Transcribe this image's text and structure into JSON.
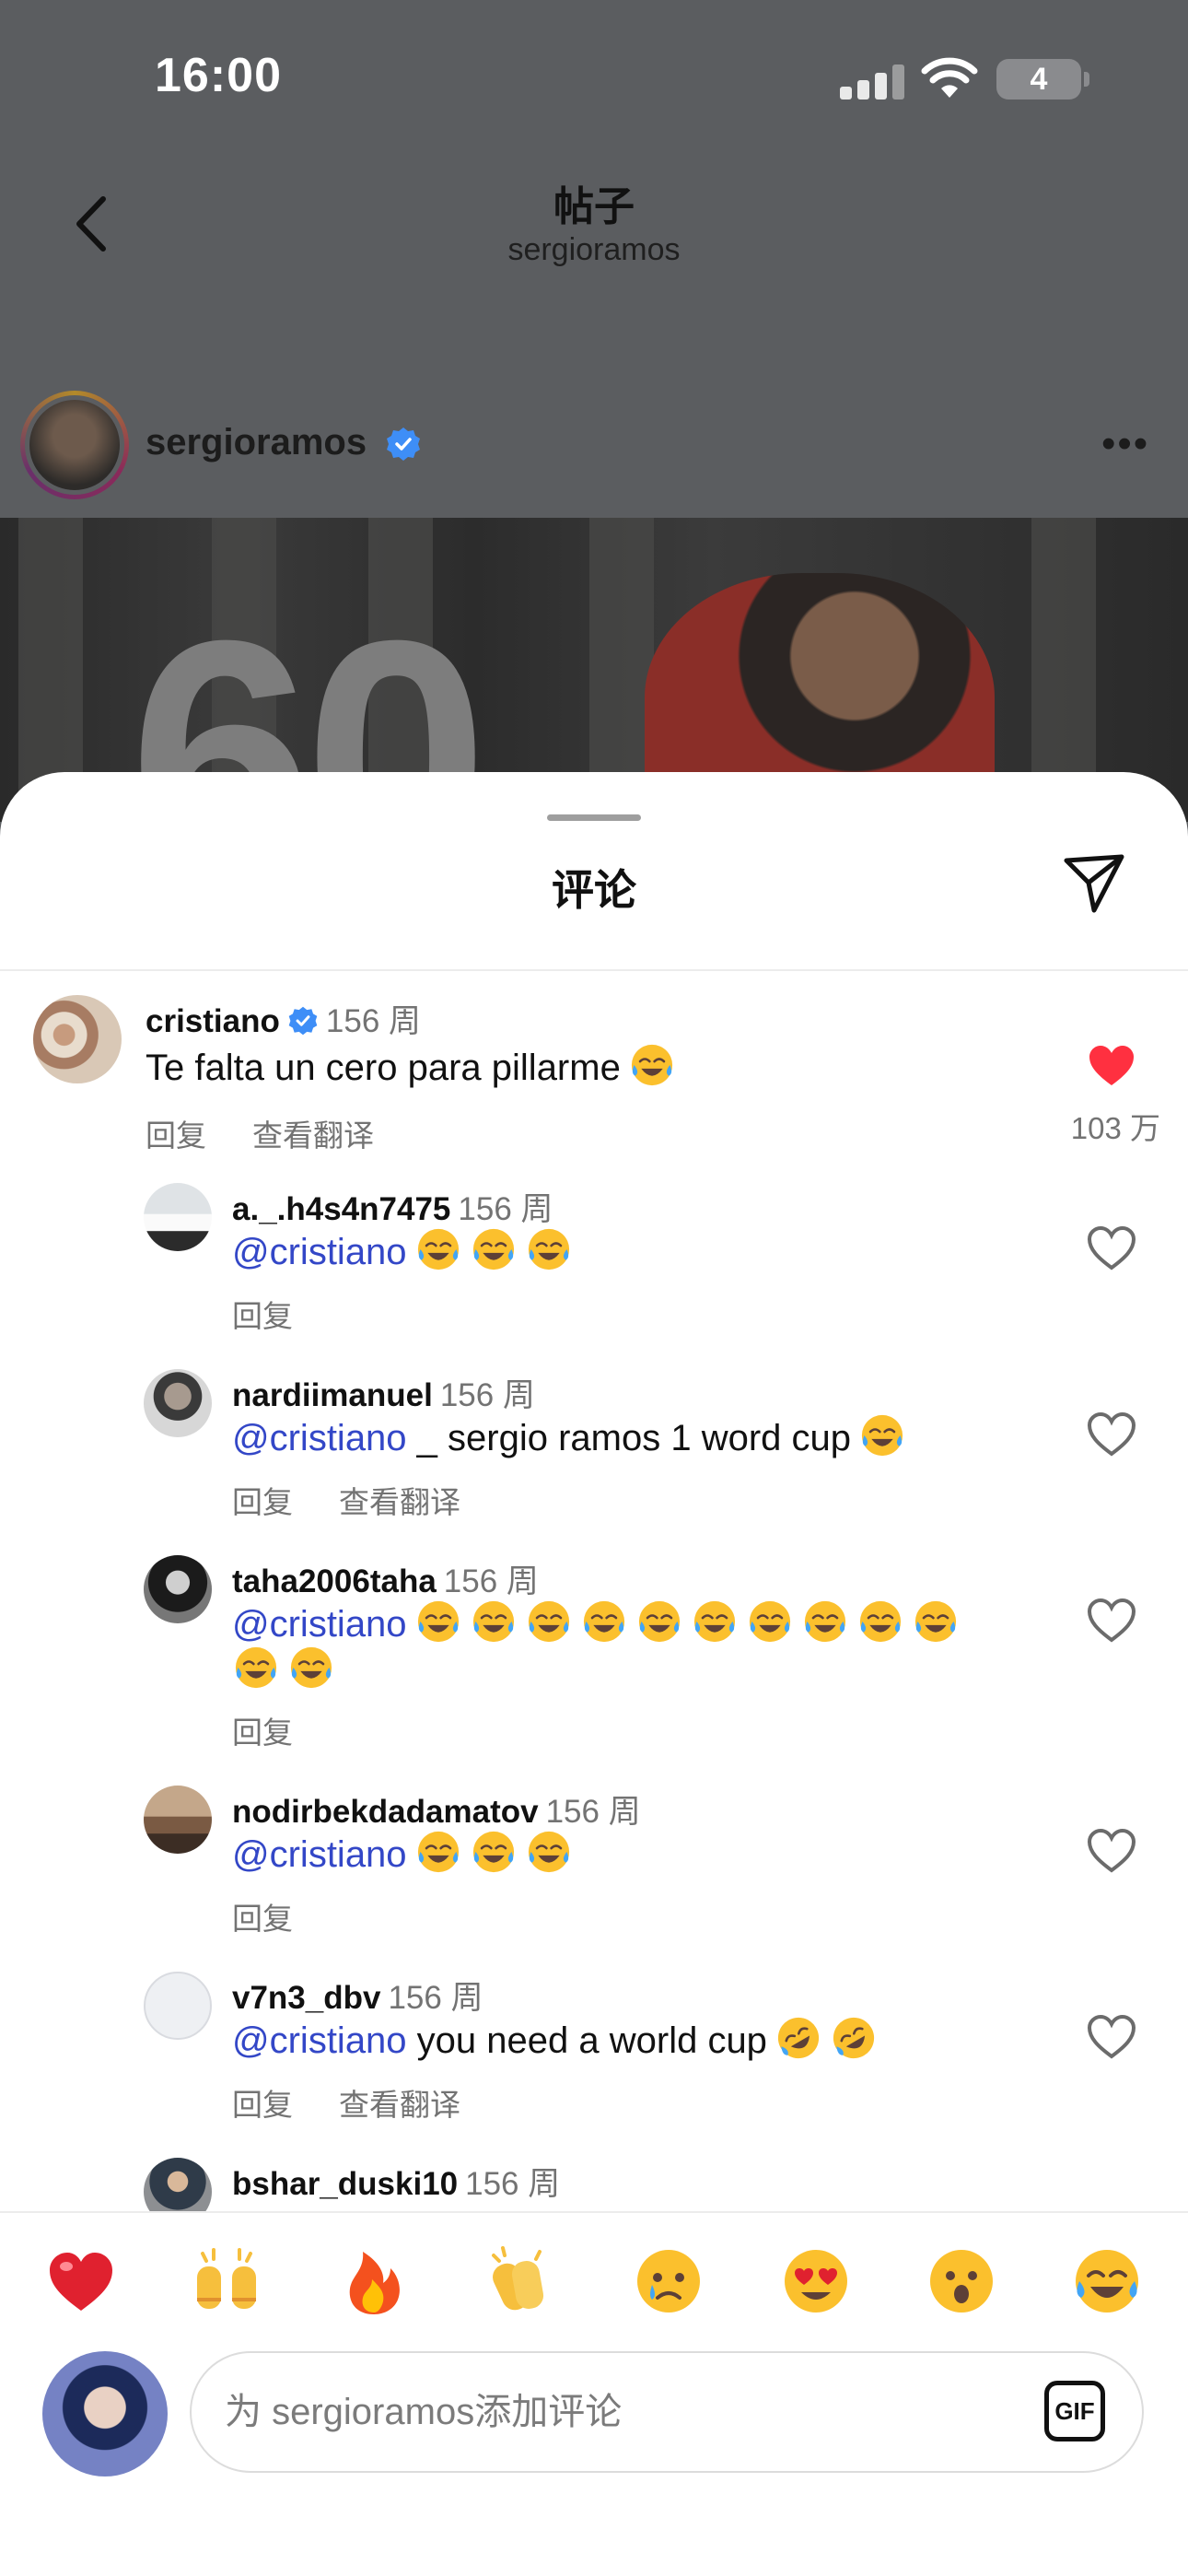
{
  "status_bar": {
    "time": "16:00",
    "battery": "4"
  },
  "header": {
    "title": "帖子",
    "subtitle": "sergioramos"
  },
  "post": {
    "username": "sergioramos"
  },
  "sheet": {
    "title": "评论"
  },
  "comments": [
    {
      "username": "cristiano",
      "verified": true,
      "time": "156 周",
      "text": "Te falta un cero para pillarme",
      "reply": "回复",
      "translate": "查看翻译",
      "liked": true,
      "likes": "103 万"
    },
    {
      "username": "a._.h4s4n7475",
      "time": "156 周",
      "mention": "@cristiano",
      "text": "",
      "reply": "回复"
    },
    {
      "username": "nardiimanuel",
      "time": "156 周",
      "mention": "@cristiano",
      "text": " _ sergio ramos 1 word cup",
      "reply": "回复",
      "translate": "查看翻译"
    },
    {
      "username": "taha2006taha",
      "time": "156 周",
      "mention": "@cristiano",
      "text": "",
      "reply": "回复"
    },
    {
      "username": "nodirbekdadamatov",
      "time": "156 周",
      "mention": "@cristiano",
      "text": "",
      "reply": "回复"
    },
    {
      "username": "v7n3_dbv",
      "time": "156 周",
      "mention": "@cristiano",
      "text": " you need a world cup",
      "reply": "回复",
      "translate": "查看翻译"
    },
    {
      "username": "bshar_duski10",
      "time": "156 周"
    }
  ],
  "reactions": [
    "red-heart",
    "raising-hands",
    "fire",
    "clapping-hands",
    "crying-face",
    "heart-eyes",
    "surprised-face",
    "tears-of-joy"
  ],
  "composer": {
    "placeholder": "为 sergioramos添加评论",
    "gif_label": "GIF"
  },
  "colors": {
    "mention": "#3347c7",
    "like_red": "#ff3040",
    "muted": "#737373"
  }
}
